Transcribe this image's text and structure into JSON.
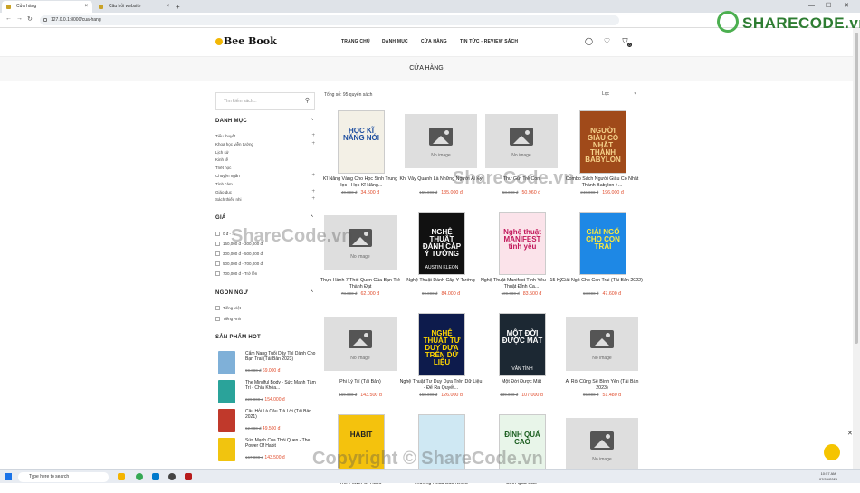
{
  "browser": {
    "tabs": [
      {
        "label": "Cửa hàng",
        "active": true
      },
      {
        "label": "Câu hỏi website",
        "active": false
      }
    ],
    "url": "127.0.0.1:8000/cua-hang"
  },
  "header": {
    "logo": "Bee Book",
    "nav": [
      "TRANG CHỦ",
      "DANH MỤC",
      "CỬA HÀNG",
      "TIN TỨC - REVIEW SÁCH"
    ],
    "cart_count": "0"
  },
  "banner": {
    "title": "CỬA HÀNG"
  },
  "sidebar": {
    "search_placeholder": "Tìm kiếm sách...",
    "category_title": "DANH MỤC",
    "categories": [
      "Tiểu thuyết",
      "Khoa học viễn tưởng",
      "Lịch sử",
      "Kinh tế",
      "Triết học",
      "Chuyện ngắn",
      "Tình cảm",
      "Giáo dục",
      "Sách thiếu nhi"
    ],
    "price_title": "GIÁ",
    "prices": [
      "0 đ - ...",
      "150,000 đ - 300,000 đ",
      "300,000 đ - 500,000 đ",
      "500,000 đ - 700,000 đ",
      "700,000 đ - Trở lên"
    ],
    "language_title": "NGÔN NGỮ",
    "languages": [
      "Tiếng Việt",
      "Tiếng Anh"
    ],
    "hot_title": "SẢN PHẨM HOT",
    "hot": [
      {
        "name": "Cẩm Nang Tuổi Dậy Thì Dành Cho Bạn Trai (Tái Bản 2023)",
        "old": "90.000 đ",
        "new": "69.000 đ",
        "color": "#7fb0d8"
      },
      {
        "name": "The Mindful Body - Sức Mạnh Tâm Trí - Chìa Khóa...",
        "old": "229.000 đ",
        "new": "154.000 đ",
        "color": "#2aa39a"
      },
      {
        "name": "Câu Hỏi Là Câu Trả Lời (Tái Bản 2021)",
        "old": "62.000 đ",
        "new": "49.500 đ",
        "color": "#c0392b"
      },
      {
        "name": "Sức Mạnh Của Thói Quen - The Power Of Habit",
        "old": "167.000 đ",
        "new": "143.500 đ",
        "color": "#f1c40f"
      }
    ]
  },
  "shop": {
    "total": "Tổng số: 95 quyển sách",
    "sort_label": "Lọc",
    "no_image": "No image",
    "products": [
      {
        "name": "Kĩ Năng Vàng Cho Học Sinh Trung Học - Học Kĩ Năng...",
        "old": "40.000 đ",
        "new": "34.500 đ",
        "img": "book",
        "cover_title": "HỌC KĨ NĂNG NÓI",
        "cover_bg": "#f3f0e6",
        "cover_fg": "#1f4fa0"
      },
      {
        "name": "Khi Vây Quanh Là Những Người Ái Kỷ",
        "old": "155.000 đ",
        "new": "135.000 đ",
        "img": "none"
      },
      {
        "name": "Thư Gửi Trẻ Con",
        "old": "58.000 đ",
        "new": "50.960 đ",
        "img": "none"
      },
      {
        "name": "Combo Sách Người Giàu Có Nhất Thành Babylon +...",
        "old": "246.000 đ",
        "new": "196.000 đ",
        "img": "book",
        "cover_title": "NGƯỜI GIÀU CÓ NHẤT THÀNH BABYLON",
        "cover_bg": "#a04a1a",
        "cover_fg": "#f6d38b"
      },
      {
        "name": "Thực Hành 7 Thói Quen Của Bạn Trẻ Thành Đạt",
        "old": "78.000 đ",
        "new": "62.000 đ",
        "img": "none"
      },
      {
        "name": "Nghệ Thuật Đánh Cắp Ý Tưởng",
        "old": "90.000 đ",
        "new": "84.000 đ",
        "img": "book",
        "cover_title": "NGHỆ THUẬT ĐÁNH CẮP Ý TƯỞNG",
        "cover_bg": "#111111",
        "cover_fg": "#ffffff",
        "cover_sub": "AUSTIN KLEON"
      },
      {
        "name": "Nghệ Thuật Manifest Tình Yêu - 15 Kỹ Thuật Đỉnh Ca...",
        "old": "109.000 đ",
        "new": "83.500 đ",
        "img": "book",
        "cover_title": "Nghệ thuật MANIFEST tình yêu",
        "cover_bg": "#fbe3ea",
        "cover_fg": "#c2185b"
      },
      {
        "name": "Giải Ngố Cho Con Trai (Tái Bản 2022)",
        "old": "68.000 đ",
        "new": "47.600 đ",
        "img": "book",
        "cover_title": "GIẢI NGỐ CHO CON TRAI",
        "cover_bg": "#1e88e5",
        "cover_fg": "#ffeb3b"
      },
      {
        "name": "Phi Lý Trí (Tái Bản)",
        "old": "169.000 đ",
        "new": "143.500 đ",
        "img": "none"
      },
      {
        "name": "Nghệ Thuật Tư Duy Dựa Trên Dữ Liệu - Để Ra Quyết...",
        "old": "158.000 đ",
        "new": "126.000 đ",
        "img": "book",
        "cover_title": "NGHỆ THUẬT TƯ DUY DỰA TRÊN DỮ LIỆU",
        "cover_bg": "#0d1b4c",
        "cover_fg": "#ffd600"
      },
      {
        "name": "Một Đời Được Mất",
        "old": "139.000 đ",
        "new": "107.000 đ",
        "img": "book",
        "cover_title": "MỘT ĐỜI ĐƯỢC MẤT",
        "cover_bg": "#1c2833",
        "cover_fg": "#ffffff",
        "cover_sub": "VÂN TÌNH"
      },
      {
        "name": "Ai Rồi Cũng Sẽ Bình Yên (Tái Bản 2023)",
        "old": "95.000 đ",
        "new": "51.480 đ",
        "img": "none"
      },
      {
        "name": "The Power Of Habit",
        "img": "book",
        "cover_title": "HABIT",
        "cover_bg": "#f4c20d",
        "cover_fg": "#222222"
      },
      {
        "name": "Thương Nhau Bao Nhiêu",
        "img": "book",
        "cover_title": "",
        "cover_bg": "#cfe8f3",
        "cover_fg": "#1565c0"
      },
      {
        "name": "Đỉnh Quá Cao",
        "img": "book",
        "cover_title": "ĐỈNH QUÁ CAO",
        "cover_bg": "#e8f5e9",
        "cover_fg": "#1b5e20"
      },
      {
        "name": "",
        "img": "none"
      }
    ]
  },
  "taskbar": {
    "search_placeholder": "Type here to search",
    "time": "10:57 AM",
    "date": "07/06/2025"
  },
  "watermark": {
    "brand": "SHARECODE.vn",
    "text": "ShareCode.vn",
    "copyright": "Copyright © ShareCode.vn"
  }
}
